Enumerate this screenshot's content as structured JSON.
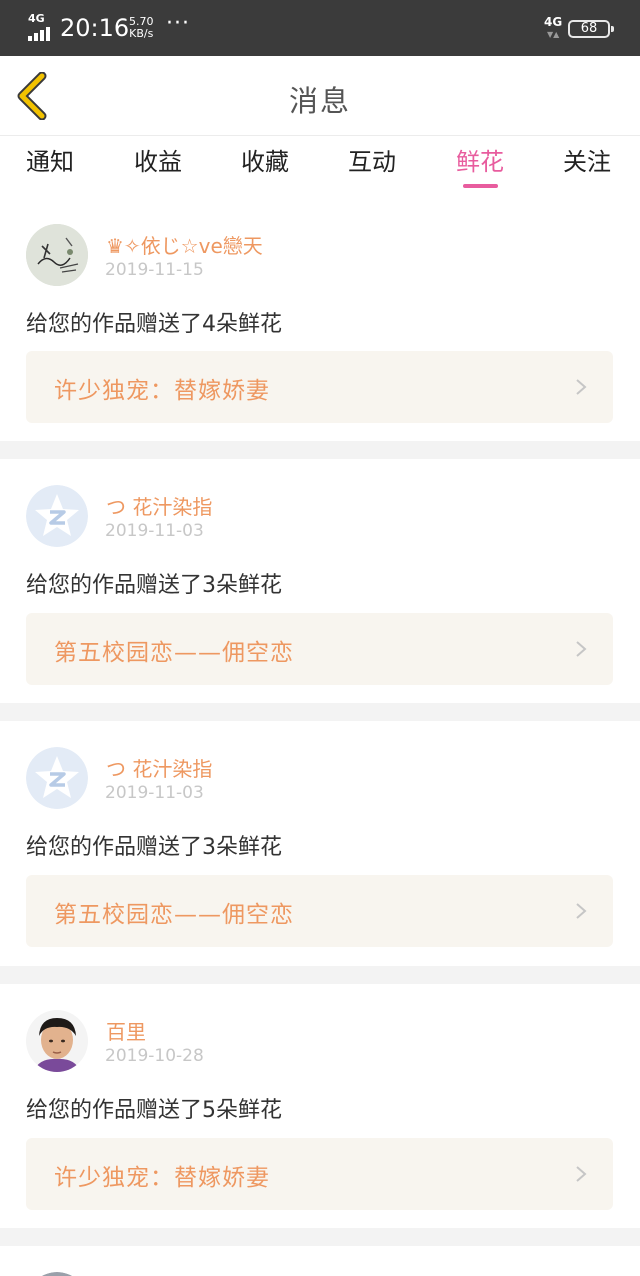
{
  "status_bar": {
    "network_label": "4G",
    "time": "20:16",
    "speed_value": "5.70",
    "speed_unit": "KB/s",
    "more": "···",
    "network_right": "4G",
    "battery": "68"
  },
  "header": {
    "title": "消息"
  },
  "tabs": [
    {
      "label": "通知"
    },
    {
      "label": "收益"
    },
    {
      "label": "收藏"
    },
    {
      "label": "互动"
    },
    {
      "label": "鲜花",
      "active": true
    },
    {
      "label": "关注"
    }
  ],
  "messages": [
    {
      "username": "♛✧依じ☆ve戀天",
      "date": "2019-11-15",
      "text": "给您的作品赠送了4朵鲜花",
      "work_title": "许少独宠：替嫁娇妻"
    },
    {
      "username": "つ 花汁染指",
      "date": "2019-11-03",
      "text": "给您的作品赠送了3朵鲜花",
      "work_title": "第五校园恋——佣空恋"
    },
    {
      "username": "つ 花汁染指",
      "date": "2019-11-03",
      "text": "给您的作品赠送了3朵鲜花",
      "work_title": "第五校园恋——佣空恋"
    },
    {
      "username": "百里",
      "date": "2019-10-28",
      "text": "给您的作品赠送了5朵鲜花",
      "work_title": "许少独宠：替嫁娇妻"
    }
  ],
  "colors": {
    "accent": "#e85c9e",
    "username": "#ee9861",
    "link_bg": "#f8f5ef",
    "back_icon": "#f2c200"
  },
  "icons": {
    "back": "chevron-left-icon",
    "link_arrow": "chevron-right-icon",
    "default_avatar": "qq-star-avatar-icon"
  }
}
